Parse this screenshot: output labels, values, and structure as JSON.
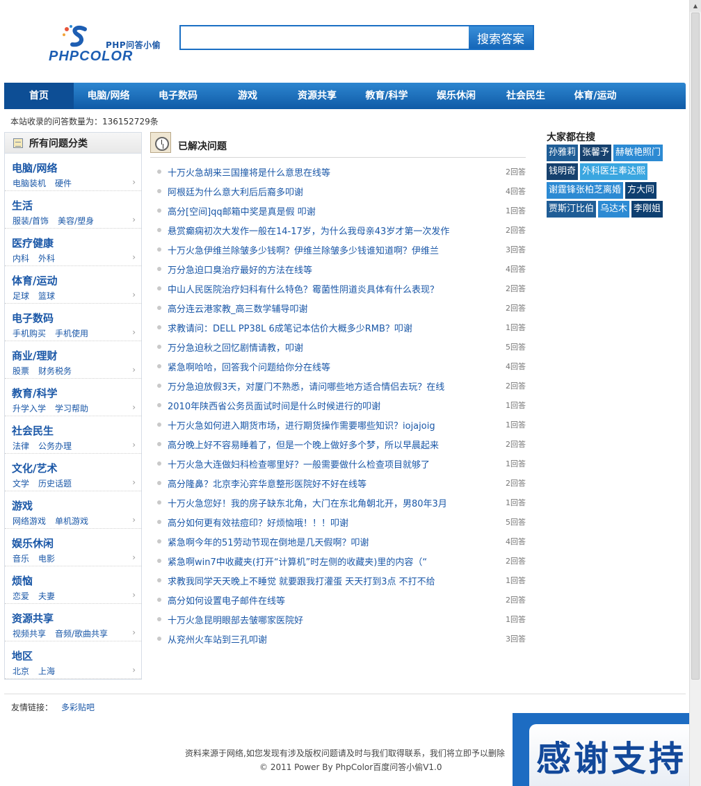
{
  "header": {
    "logo_cn": "PHP问答小偷",
    "logo_en": "PHPCOLOR",
    "search_placeholder": "",
    "search_button": "搜索答案"
  },
  "nav": [
    "首页",
    "电脑/网络",
    "电子数码",
    "游戏",
    "资源共享",
    "教育/科学",
    "娱乐休闲",
    "社会民生",
    "体育/运动"
  ],
  "count_text": "本站收录的问答数量为：136152729条",
  "sidebar": {
    "title": "所有问题分类",
    "categories": [
      {
        "name": "电脑/网络",
        "subs": [
          "电脑装机",
          "硬件"
        ]
      },
      {
        "name": "生活",
        "subs": [
          "服装/首饰",
          "美容/塑身"
        ]
      },
      {
        "name": "医疗健康",
        "subs": [
          "内科",
          "外科"
        ]
      },
      {
        "name": "体育/运动",
        "subs": [
          "足球",
          "篮球"
        ]
      },
      {
        "name": "电子数码",
        "subs": [
          "手机购买",
          "手机使用"
        ]
      },
      {
        "name": "商业/理财",
        "subs": [
          "股票",
          "财务税务"
        ]
      },
      {
        "name": "教育/科学",
        "subs": [
          "升学入学",
          "学习帮助"
        ]
      },
      {
        "name": "社会民生",
        "subs": [
          "法律",
          "公务办理"
        ]
      },
      {
        "name": "文化/艺术",
        "subs": [
          "文学",
          "历史话题"
        ]
      },
      {
        "name": "游戏",
        "subs": [
          "网络游戏",
          "单机游戏"
        ]
      },
      {
        "name": "娱乐休闲",
        "subs": [
          "音乐",
          "电影"
        ]
      },
      {
        "name": "烦恼",
        "subs": [
          "恋爱",
          "夫妻"
        ]
      },
      {
        "name": "资源共享",
        "subs": [
          "视频共享",
          "音频/歌曲共享"
        ]
      },
      {
        "name": "地区",
        "subs": [
          "北京",
          "上海"
        ]
      }
    ]
  },
  "main": {
    "title": "已解决问题",
    "questions": [
      {
        "text": "十万火急胡来三国撞将是什么意思在线等",
        "answers": "2回答"
      },
      {
        "text": "阿根廷为什么意大利后后裔多叩谢",
        "answers": "4回答"
      },
      {
        "text": "高分[空间]qq邮箱中奖是真是假 叩谢",
        "answers": "1回答"
      },
      {
        "text": "悬赏癫痫初次大发作一般在14-17岁，为什么我母亲43岁才第一次发作",
        "answers": "2回答"
      },
      {
        "text": "十万火急伊维兰除皱多少钱啊？伊维兰除皱多少钱谁知道啊？伊维兰",
        "answers": "3回答"
      },
      {
        "text": "万分急迫口臭治疗最好的方法在线等",
        "answers": "4回答"
      },
      {
        "text": "中山人民医院治疗妇科有什么特色？霉菌性阴道炎具体有什么表现？",
        "answers": "2回答"
      },
      {
        "text": "高分连云港家教_高三数学辅导叩谢",
        "answers": "2回答"
      },
      {
        "text": "求教请问：DELL PP38L 6成笔记本估价大概多少RMB？叩谢",
        "answers": "1回答"
      },
      {
        "text": "万分急迫秋之回忆剧情请教，叩谢",
        "answers": "5回答"
      },
      {
        "text": "紧急啊哈哈，回答我个问题给你分在线等",
        "answers": "4回答"
      },
      {
        "text": "万分急迫放假3天，对厦门不熟悉，请问哪些地方适合情侣去玩？在线",
        "answers": "2回答"
      },
      {
        "text": "2010年陕西省公务员面试时间是什么时候进行的叩谢",
        "answers": "1回答"
      },
      {
        "text": "十万火急如何进入期货市场，进行期货操作需要哪些知识？iojajoig",
        "answers": "1回答"
      },
      {
        "text": "高分晚上好不容易睡着了，但是一个晚上做好多个梦，所以早晨起来",
        "answers": "2回答"
      },
      {
        "text": "十万火急大连做妇科检查哪里好？一般需要做什么检查项目就够了",
        "answers": "1回答"
      },
      {
        "text": "高分隆鼻？北京李沁弈华意整形医院好不好在线等",
        "answers": "2回答"
      },
      {
        "text": "十万火急您好！我的房子缺东北角，大门在东北角朝北开，男80年3月",
        "answers": "1回答"
      },
      {
        "text": "高分如何更有效祛痘印？好烦恼哦！！！叩谢",
        "answers": "5回答"
      },
      {
        "text": "紧急啊今年的51劳动节现在倒地是几天假啊？叩谢",
        "answers": "4回答"
      },
      {
        "text": "紧急啊win7中收藏夹(打开“计算机”时左侧的收藏夹)里的内容（“",
        "answers": "2回答"
      },
      {
        "text": "求教我同学天天晚上不睡觉 就要跟我打灌蛋 天天打到3点 不打不给",
        "answers": "1回答"
      },
      {
        "text": "高分如何设置电子邮件在线等",
        "answers": "2回答"
      },
      {
        "text": "十万火急昆明眼部去皱哪家医院好",
        "answers": "1回答"
      },
      {
        "text": "从兖州火车站到三孔叩谢",
        "answers": "3回答"
      }
    ]
  },
  "hot": {
    "title": "大家都在搜",
    "rows": [
      [
        {
          "text": "孙雅莉",
          "color": "#1f5d96"
        },
        {
          "text": "张馨予",
          "color": "#16416e"
        },
        {
          "text": "赫敏艳照门",
          "color": "#2c8ad3"
        }
      ],
      [
        {
          "text": "钱明奇",
          "color": "#16416e"
        },
        {
          "text": "外科医生奉达熙",
          "color": "#3aa6e0"
        }
      ],
      [
        {
          "text": "谢霆锋张柏芝离婚",
          "color": "#2c8ad3"
        },
        {
          "text": "方大同",
          "color": "#0e3f70"
        }
      ],
      [
        {
          "text": "贾斯汀比伯",
          "color": "#1f5d96"
        },
        {
          "text": "乌达木",
          "color": "#2c8ad3"
        },
        {
          "text": "李刚姐",
          "color": "#0e3f70"
        }
      ]
    ]
  },
  "footer": {
    "friends_label": "友情链接：",
    "friends_link": "多彩贴吧",
    "line1": "资料来源于网络,如您发现有涉及版权问题请及时与我们取得联系，我们将立即予以删除",
    "line2": "© 2011 Power By PhpColor百度问答小偷V1.0"
  },
  "banner": {
    "text": "感谢支持"
  }
}
